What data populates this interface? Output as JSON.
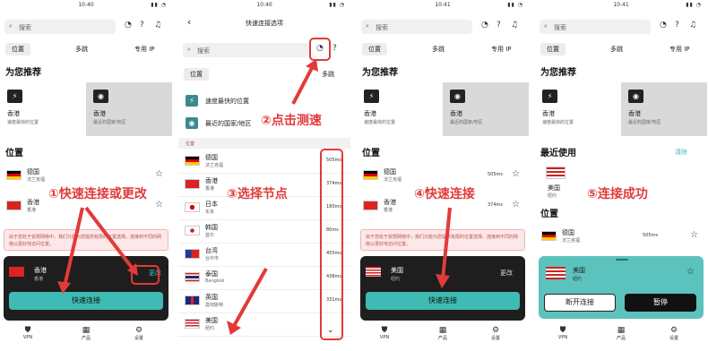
{
  "status": {
    "t1": "10:40",
    "t2": "10:40",
    "t3": "10:41",
    "t4": "10:41"
  },
  "search": {
    "placeholder": "搜索"
  },
  "tabs": {
    "a": "位置",
    "b": "多跳",
    "c": "专用 IP"
  },
  "sections": {
    "recommend": "为您推荐",
    "locations": "位置",
    "recent": "最近使用",
    "clear": "清除"
  },
  "rec": {
    "fast_title": "香港",
    "fast_sub": "速度最快的位置",
    "country_title": "香港",
    "country_sub": "最近的国家/地区"
  },
  "rows": [
    {
      "name": "德国",
      "sub": "法兰克福"
    },
    {
      "name": "香港",
      "sub": "香港"
    }
  ],
  "panel4": {
    "us": "美国",
    "us_sub": "纽约",
    "de": "德国",
    "de_sub": "法兰克福",
    "de_ms": "505ms"
  },
  "warn": "由于您处于受限网络中，我们只能为您提供有限的位置选择。连接到不同的网络以更好地访问位置。",
  "card1": {
    "name": "香港",
    "sub": "香港",
    "change": "更改",
    "btn": "快速连接"
  },
  "card3": {
    "name": "美国",
    "sub": "纽约",
    "change": "更改",
    "btn": "快速连接"
  },
  "card4": {
    "name": "美国",
    "sub": "纽约",
    "disconnect": "断开连接",
    "pause": "暂停"
  },
  "panel3": {
    "de_ms": "505ms",
    "hk_ms": "374ms"
  },
  "speedtest": {
    "title": "快速连接选项",
    "fastest": "速度最快的位置",
    "nearest": "最近的国家/地区",
    "section": "位置",
    "multi": "多跳",
    "tab": "位置"
  },
  "nodes": [
    {
      "name": "德国",
      "sub": "法兰克福",
      "ms": "505ms"
    },
    {
      "name": "香港",
      "sub": "香港",
      "ms": "374ms"
    },
    {
      "name": "日本",
      "sub": "东京",
      "ms": "180ms"
    },
    {
      "name": "韩国",
      "sub": "首尔",
      "ms": "80ms"
    },
    {
      "name": "台湾",
      "sub": "台中市",
      "ms": "455ms"
    },
    {
      "name": "泰国",
      "sub": "Bangkok",
      "ms": "438ms"
    },
    {
      "name": "英国",
      "sub": "曼彻斯特",
      "ms": "331ms"
    },
    {
      "name": "美国",
      "sub": "纽约",
      "ms": ""
    }
  ],
  "nav": {
    "vpn": "VPN",
    "products": "产品",
    "settings": "设置"
  },
  "annotations": {
    "a1": "①快速连接或更改",
    "a2": "②点击测速",
    "a3": "③选择节点",
    "a4": "④快速连接",
    "a5": "⑤连接成功"
  },
  "colors": {
    "accent": "#3fbab4",
    "annot": "#e23a3a"
  }
}
